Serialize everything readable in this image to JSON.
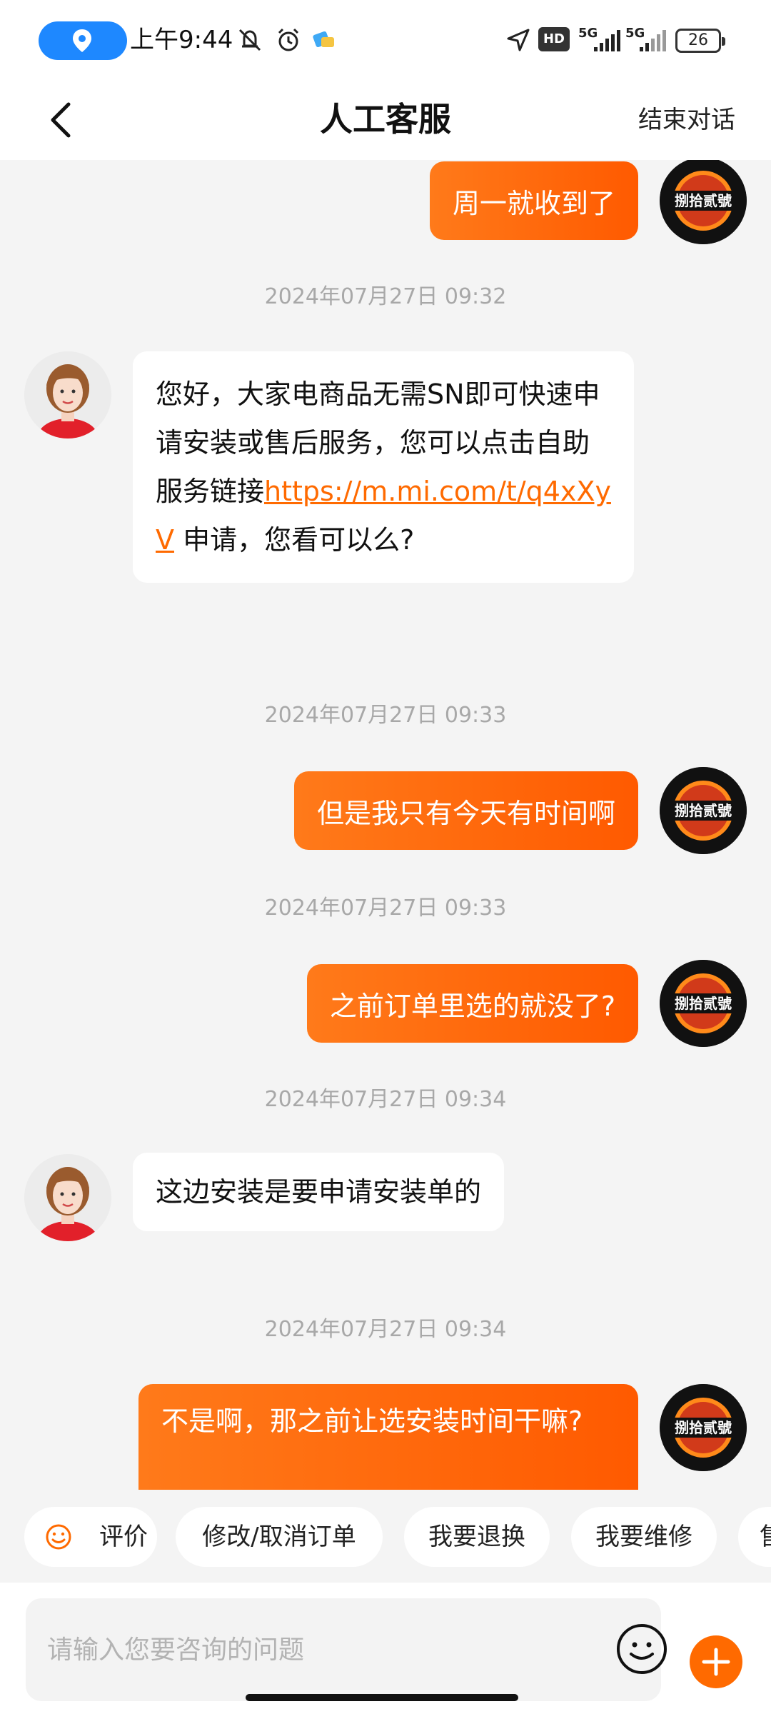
{
  "status_bar": {
    "time": "上午9:44",
    "hd_label": "HD",
    "net1": "5G",
    "net2": "5G",
    "battery": "26",
    "icons": [
      "location-pill-icon",
      "mute-icon",
      "alarm-icon",
      "app-notification-icon",
      "navigation-arrow-icon",
      "signal-icon"
    ]
  },
  "header": {
    "title": "人工客服",
    "end_label": "结束对话",
    "back_icon": "chevron-left-icon"
  },
  "messages": {
    "m1": {
      "sender": "user",
      "text": "周一就收到了"
    },
    "t1": "2024年07月27日 09:32",
    "m2": {
      "sender": "agent",
      "text_before": "您好，大家电商品无需SN即可快速申请安装或售后服务，您可以点击自助服务链接",
      "link": "https://m.mi.com/t/q4xXyV",
      "text_after": " 申请，您看可以么?"
    },
    "t2": "2024年07月27日 09:33",
    "m3": {
      "sender": "user",
      "text": "但是我只有今天有时间啊"
    },
    "t3": "2024年07月27日 09:33",
    "m4": {
      "sender": "user",
      "text": "之前订单里选的就没了?"
    },
    "t4": "2024年07月27日 09:34",
    "m5": {
      "sender": "agent",
      "text": "这边安装是要申请安装单的"
    },
    "t5": "2024年07月27日 09:34",
    "m6": {
      "sender": "user",
      "text": "不是啊，那之前让选安装时间干嘛?"
    }
  },
  "avatars": {
    "user_badge_text": "捌拾贰號"
  },
  "quick_actions": [
    "评价",
    "修改/取消订单",
    "我要退换",
    "我要维修",
    "售"
  ],
  "input": {
    "placeholder": "请输入您要咨询的问题",
    "value": ""
  },
  "colors": {
    "accent": "#ff6a00",
    "link": "#ff6a00",
    "location_pill": "#1e88ff"
  }
}
